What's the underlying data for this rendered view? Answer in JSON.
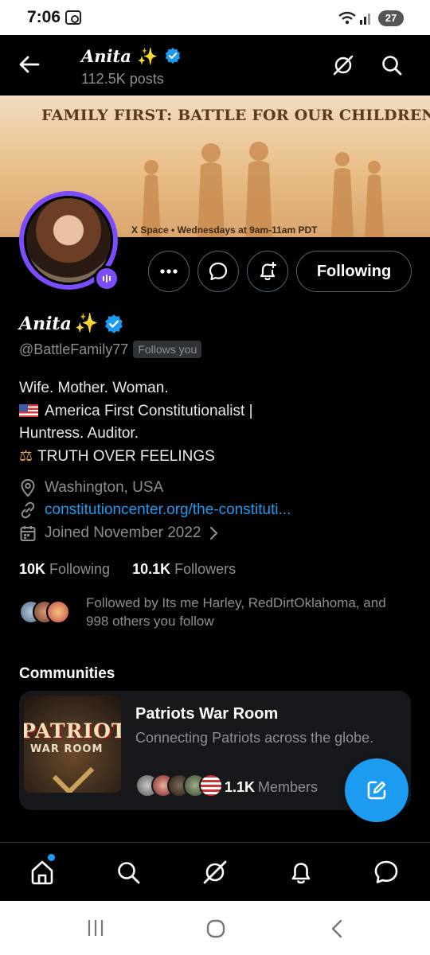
{
  "status_bar": {
    "time": "7:06",
    "battery": "27",
    "icons": [
      "screenshot-icon",
      "wifi-icon",
      "signal-icon",
      "battery-icon"
    ]
  },
  "topbar": {
    "name": "Anita",
    "sparkle": "✨",
    "posts": "112.5K posts",
    "icons": [
      "back-arrow-icon",
      "grok-icon",
      "search-icon"
    ]
  },
  "banner": {
    "title": "FAMILY FIRST: BATTLE FOR OUR CHILDREN & FUTURE",
    "subtitle_brand": "X Space",
    "subtitle_sep": "•",
    "subtitle_schedule": "Wednesdays at 9am-11am PDT"
  },
  "actions": {
    "following_label": "Following",
    "icons": [
      "more-icon",
      "message-icon",
      "notify-bell-icon"
    ]
  },
  "profile": {
    "name": "Anita",
    "sparkle": "✨",
    "handle": "@BattleFamily77",
    "follows_you": "Follows you",
    "bio": [
      "Wife. Mother. Woman.",
      "America First Constitutionalist |",
      " Huntress. Auditor.",
      "TRUTH OVER FEELINGS"
    ],
    "bio_emoji": {
      "flag": "🇺🇸",
      "scales": "⚖️"
    },
    "location": "Washington, USA",
    "website": "constitutioncenter.org/the-constituti...",
    "joined": "Joined November 2022",
    "following_count": "10K",
    "following_label": "Following",
    "followers_count": "10.1K",
    "followers_label": "Followers",
    "followed_by_text": "Followed by Its me Harley, RedDirtOklahoma, and 998 others you follow"
  },
  "communities": {
    "title": "Communities",
    "items": [
      {
        "image_text_1": "PATRIOTS",
        "image_text_2": "WAR ROOM",
        "name": "Patriots War Room",
        "description": "Connecting Patriots across the globe.",
        "members_count": "1.1K",
        "members_label": "Members"
      }
    ]
  },
  "bottom_nav": {
    "items": [
      "home-icon",
      "search-icon",
      "grok-icon",
      "notifications-icon",
      "messages-icon"
    ]
  },
  "colors": {
    "accent": "#1d9bf0",
    "ring": "#7c4dff",
    "background": "#000000",
    "muted": "#8b8f94"
  }
}
